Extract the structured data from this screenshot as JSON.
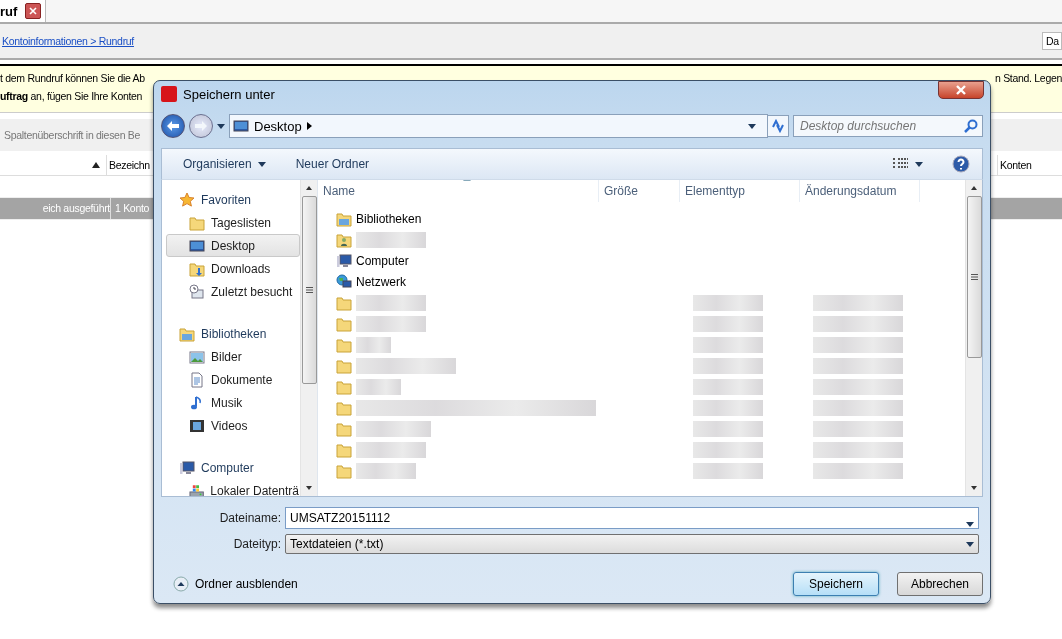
{
  "background_app": {
    "tab": {
      "label": "ruf",
      "selected": true
    },
    "breadcrumb": "Kontoinformationen > Rundruf",
    "date_field": "Da",
    "info_lines": [
      "t dem Rundruf können Sie die Ab",
      "**uftrag** an, fügen Sie Ihre Konten"
    ],
    "info_line_end": "n Stand. Legen",
    "group_hint": "Spaltenüberschrift in diesen Be",
    "columns": [
      "",
      "Bezeichn",
      "Konten"
    ],
    "rows": [
      {
        "cells": [
          "eich ausgeführt",
          "1 Konto",
          ""
        ],
        "selected": true
      }
    ]
  },
  "dialog": {
    "title": "Speichern unter",
    "address": "Desktop",
    "search": {
      "placeholder": "Desktop durchsuchen"
    },
    "toolbar": [
      "Organisieren",
      "Neuer Ordner"
    ],
    "nav": [
      {
        "label": "Favoriten",
        "kind": "star",
        "children": [
          {
            "label": "Tageslisten",
            "kind": "folder",
            "selected": false
          },
          {
            "label": "Desktop",
            "kind": "desktop",
            "selected": true
          },
          {
            "label": "Downloads",
            "kind": "download",
            "selected": false
          },
          {
            "label": "Zuletzt besucht",
            "kind": "recent",
            "selected": false
          }
        ]
      },
      {
        "label": "Bibliotheken",
        "kind": "library",
        "children": [
          {
            "label": "Bilder",
            "kind": "pictures",
            "selected": false
          },
          {
            "label": "Dokumente",
            "kind": "documents",
            "selected": false
          },
          {
            "label": "Musik",
            "kind": "music",
            "selected": false
          },
          {
            "label": "Videos",
            "kind": "video",
            "selected": false
          }
        ]
      },
      {
        "label": "Computer",
        "kind": "computer",
        "children": [
          {
            "label": "Lokaler Datenträ",
            "kind": "drive",
            "selected": false
          }
        ]
      }
    ],
    "columns": [
      "Name",
      "Größe",
      "Elementtyp",
      "Änderungsdatum"
    ],
    "files": [
      {
        "name": "Bibliotheken",
        "kind": "library",
        "redacted": false
      },
      {
        "kind": "user",
        "redacted": true
      },
      {
        "name": "Computer",
        "kind": "computer",
        "redacted": false
      },
      {
        "name": "Netzwerk",
        "kind": "network",
        "redacted": false
      },
      {
        "kind": "folder",
        "redacted": true
      },
      {
        "kind": "folder",
        "redacted": true
      },
      {
        "kind": "folder",
        "redacted": true
      },
      {
        "kind": "folder",
        "redacted": true
      },
      {
        "kind": "folder",
        "redacted": true
      },
      {
        "kind": "folder",
        "redacted": true
      },
      {
        "kind": "folder",
        "redacted": true
      },
      {
        "kind": "folder",
        "redacted": true
      },
      {
        "kind": "folder",
        "redacted": true
      }
    ],
    "filename": {
      "label": "Dateiname:",
      "value": "UMSATZ20151112"
    },
    "filetype": {
      "label": "Dateityp:",
      "value": "Textdateien (*.txt)"
    },
    "hide_folders": "Ordner ausblenden",
    "buttons": [
      {
        "label": "Speichern",
        "default": true
      },
      {
        "label": "Abbrechen",
        "default": false
      }
    ]
  }
}
